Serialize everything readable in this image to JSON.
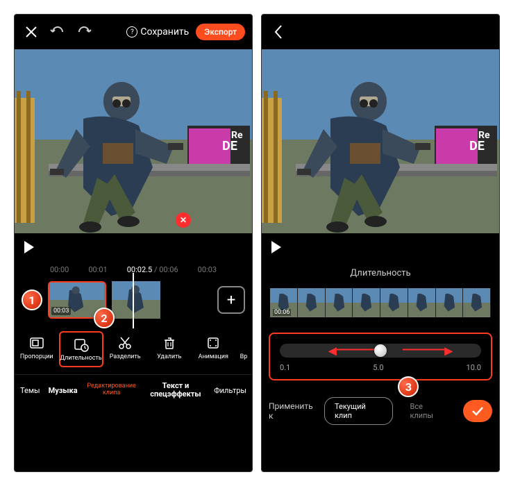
{
  "screen1": {
    "topbar": {
      "save_label": "Сохранить",
      "export_label": "Экспорт"
    },
    "timeline": {
      "t1": "00:00",
      "t2": "00:01",
      "current": "00:02.",
      "current_frac": "5",
      "total": "00:06",
      "t4": "00:03",
      "clip_time": "00:03"
    },
    "tools": {
      "proportions": "Пропорции",
      "duration": "Длительность",
      "split": "Разделить",
      "delete": "Удалить",
      "animation": "Анимация",
      "crop": "Вр"
    },
    "tabs": {
      "themes": "Темы",
      "music": "Музыка",
      "editing": "Редактирование клипа",
      "texteffects": "Текст и спецэффекты",
      "filters": "Фильтры"
    },
    "markers": {
      "m1": "1",
      "m2": "2"
    }
  },
  "screen2": {
    "title": "Длительность",
    "film_time": "00:06",
    "slider": {
      "min": "0.1",
      "mid": "5.0",
      "max": "10.0"
    },
    "apply": {
      "label": "Применить к",
      "current": "Текущий клип",
      "all": "Все клипы"
    },
    "markers": {
      "m3": "3"
    }
  }
}
